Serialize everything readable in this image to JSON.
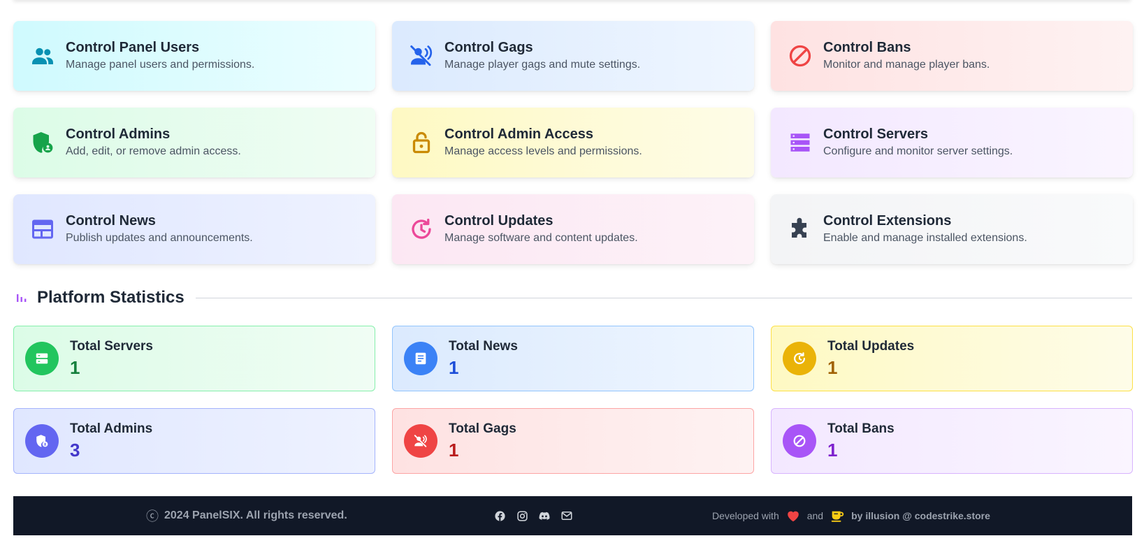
{
  "controls": [
    {
      "title": "Control Panel Users",
      "desc": "Manage panel users and permissions."
    },
    {
      "title": "Control Gags",
      "desc": "Manage player gags and mute settings."
    },
    {
      "title": "Control Bans",
      "desc": "Monitor and manage player bans."
    },
    {
      "title": "Control Admins",
      "desc": "Add, edit, or remove admin access."
    },
    {
      "title": "Control Admin Access",
      "desc": "Manage access levels and permissions."
    },
    {
      "title": "Control Servers",
      "desc": "Configure and monitor server settings."
    },
    {
      "title": "Control News",
      "desc": "Publish updates and announcements."
    },
    {
      "title": "Control Updates",
      "desc": "Manage software and content updates."
    },
    {
      "title": "Control Extensions",
      "desc": "Enable and manage installed extensions."
    }
  ],
  "statistics": {
    "title": "Platform Statistics",
    "items": [
      {
        "label": "Total Servers",
        "value": "1"
      },
      {
        "label": "Total News",
        "value": "1"
      },
      {
        "label": "Total Updates",
        "value": "1"
      },
      {
        "label": "Total Admins",
        "value": "3"
      },
      {
        "label": "Total Gags",
        "value": "1"
      },
      {
        "label": "Total Bans",
        "value": "1"
      }
    ]
  },
  "footer": {
    "copyright_symbol": "ⓒ",
    "copyright": "2024 PanelSIX. All rights reserved.",
    "developed_with": "Developed with",
    "and": "and",
    "by": "by illusion @ codestrike.store"
  },
  "colors": {
    "cyan": "#0891b2",
    "blue": "#2563eb",
    "red": "#ef4444",
    "green": "#16a34a",
    "yellow": "#ca8a04",
    "purple": "#a855f7",
    "indigo": "#6366f1",
    "pink": "#ec4899",
    "gray": "#374151",
    "footer_bg": "#111827"
  }
}
